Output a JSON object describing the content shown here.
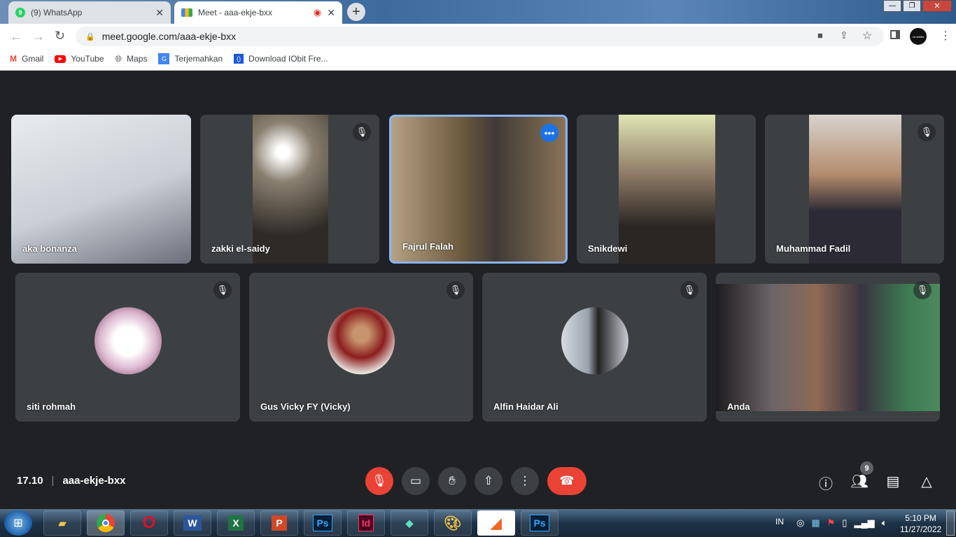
{
  "browser": {
    "tabs": [
      {
        "title": "(9) WhatsApp",
        "badge": "9",
        "active": false
      },
      {
        "title": "Meet - aaa-ekje-bxx",
        "active": true
      }
    ],
    "new_tab": "+",
    "url": "meet.google.com/aaa-ekje-bxx",
    "profile": "na ladkila",
    "bookmarks": [
      "Gmail",
      "YouTube",
      "Maps",
      "Terjemahkan",
      "Download IObit Fre..."
    ]
  },
  "meet": {
    "participants": [
      {
        "name": "aka bonanza",
        "muted": false
      },
      {
        "name": "zakki el-saidy",
        "muted": true
      },
      {
        "name": "Fajrul Falah",
        "muted": false,
        "speaking": true
      },
      {
        "name": "Snikdewi",
        "muted": false
      },
      {
        "name": "Muhammad Fadil",
        "muted": true
      },
      {
        "name": "siti rohmah",
        "muted": true
      },
      {
        "name": "Gus Vicky FY (Vicky)",
        "muted": true
      },
      {
        "name": "Alfin Haidar Ali",
        "muted": true
      },
      {
        "name": "Anda",
        "muted": true
      }
    ],
    "time": "17.10",
    "meeting_code": "aaa-ekje-bxx",
    "participant_count": "9",
    "accent_red": "#ea4335",
    "accent_blue": "#8ab4f8"
  },
  "taskbar": {
    "apps": [
      "File Explorer",
      "Chrome",
      "Opera",
      "Word",
      "Excel",
      "PowerPoint",
      "Photoshop",
      "InDesign",
      "Filmora",
      "Paint",
      "Foxit",
      "Photoshop"
    ],
    "lang": "IN",
    "time": "5:10 PM",
    "date": "11/27/2022"
  }
}
